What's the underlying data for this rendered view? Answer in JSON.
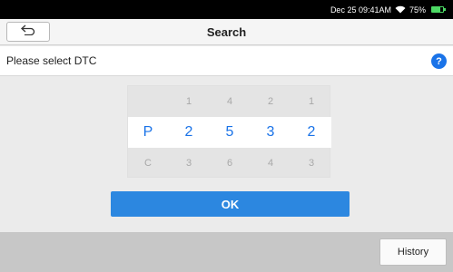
{
  "status_bar": {
    "datetime": "Dec 25 09:41AM",
    "battery": "75%",
    "battery_level": 0.75,
    "battery_color": "#4cd964",
    "icons": [
      "wifi-icon",
      "battery-icon"
    ]
  },
  "header": {
    "back_icon": "back-arrow-icon",
    "title": "Search"
  },
  "prompt": {
    "text": "Please select DTC",
    "help_icon": "help-icon",
    "help_glyph": "?"
  },
  "picker": {
    "rows": {
      "above": [
        "",
        "1",
        "4",
        "2",
        "1"
      ],
      "selected": [
        "P",
        "2",
        "5",
        "3",
        "2"
      ],
      "below": [
        "C",
        "3",
        "6",
        "4",
        "3"
      ]
    }
  },
  "actions": {
    "ok_label": "OK",
    "history_label": "History"
  },
  "colors": {
    "accent": "#1a73e8",
    "ok_button": "#2c87e0",
    "bottom_bar": "#c7c7c7"
  }
}
